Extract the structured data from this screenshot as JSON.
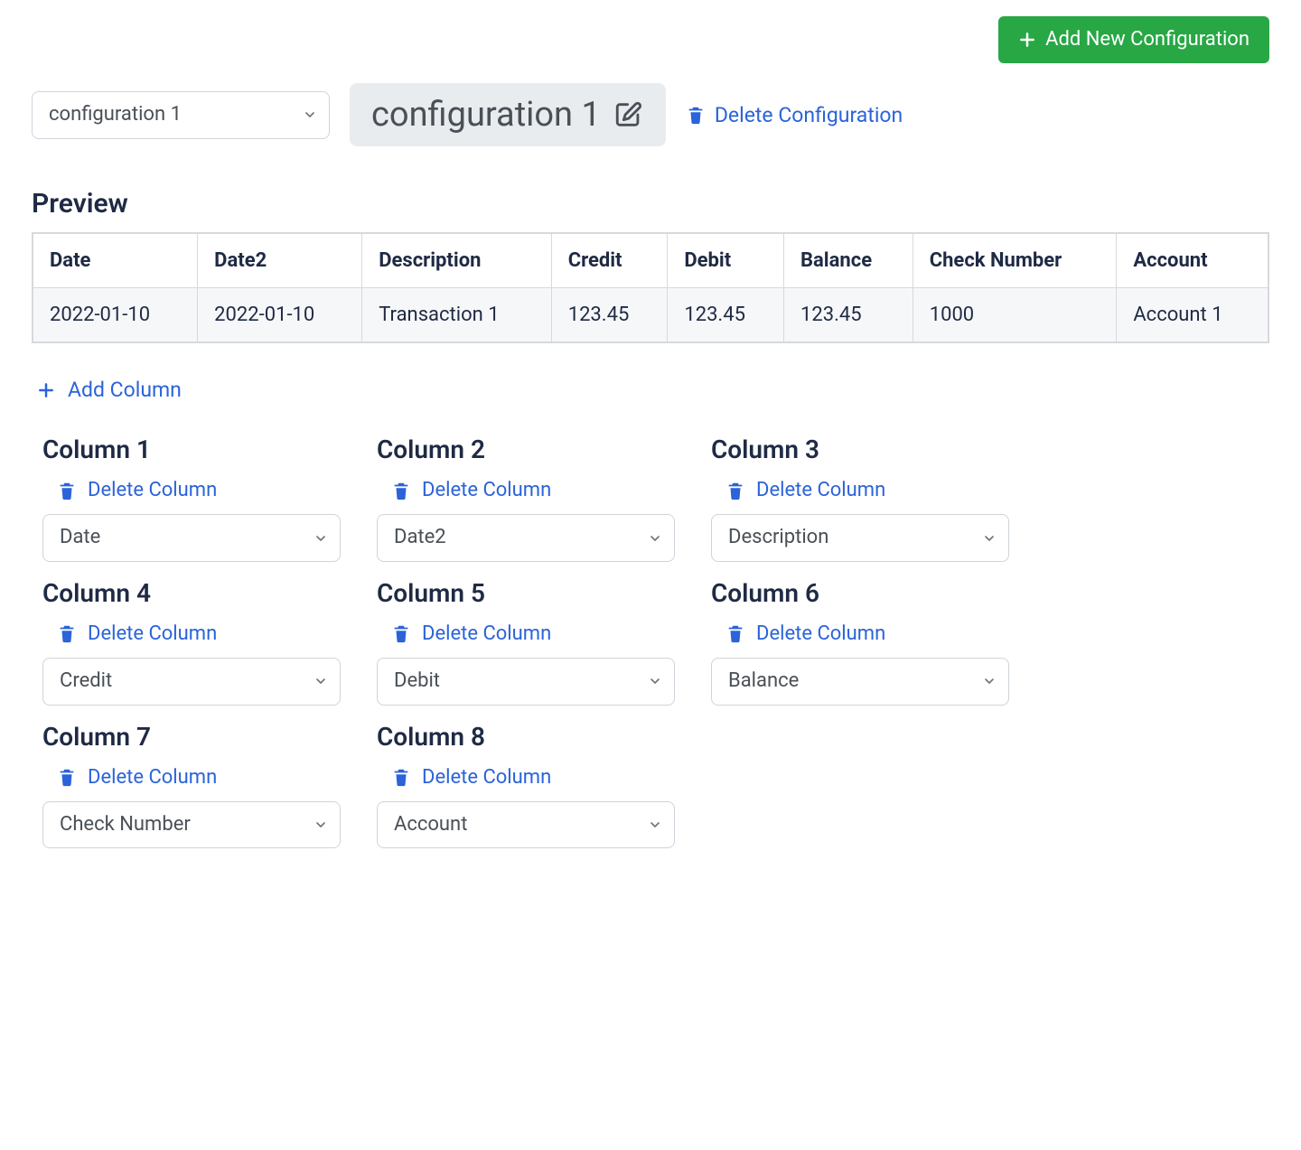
{
  "actions": {
    "add_new_configuration": "Add New Configuration",
    "delete_configuration": "Delete Configuration",
    "add_column": "Add Column",
    "delete_column": "Delete Column"
  },
  "config_select": {
    "selected": "configuration 1"
  },
  "config_title": "configuration 1",
  "preview": {
    "heading": "Preview",
    "headers": [
      "Date",
      "Date2",
      "Description",
      "Credit",
      "Debit",
      "Balance",
      "Check Number",
      "Account"
    ],
    "rows": [
      [
        "2022-01-10",
        "2022-01-10",
        "Transaction 1",
        "123.45",
        "123.45",
        "123.45",
        "1000",
        "Account 1"
      ]
    ]
  },
  "columns": [
    {
      "title": "Column 1",
      "value": "Date"
    },
    {
      "title": "Column 2",
      "value": "Date2"
    },
    {
      "title": "Column 3",
      "value": "Description"
    },
    {
      "title": "Column 4",
      "value": "Credit"
    },
    {
      "title": "Column 5",
      "value": "Debit"
    },
    {
      "title": "Column 6",
      "value": "Balance"
    },
    {
      "title": "Column 7",
      "value": "Check Number"
    },
    {
      "title": "Column 8",
      "value": "Account"
    }
  ],
  "colors": {
    "link": "#2b63d9",
    "success": "#28a745",
    "border": "#ced4da",
    "pill_bg": "#e9ecef"
  }
}
